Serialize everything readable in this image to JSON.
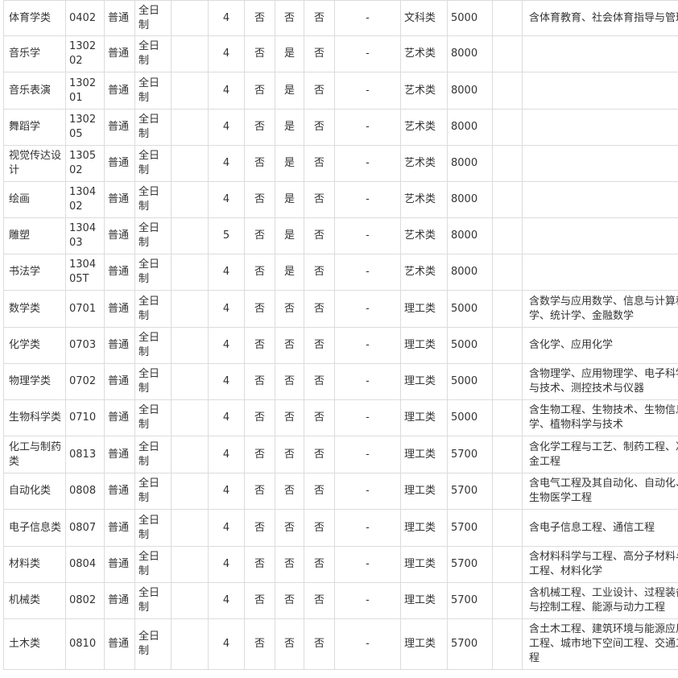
{
  "rows": [
    {
      "major": "体育学类",
      "code": "0402",
      "type": "普通",
      "mode": "全日制",
      "blank": "",
      "years": "4",
      "f1": "否",
      "f2": "否",
      "f3": "否",
      "f4": "-",
      "category": "文科类",
      "fee": "5000",
      "blank2": "",
      "note": "含体育教育、社会体育指导与管理"
    },
    {
      "major": "音乐学",
      "code": "130202",
      "type": "普通",
      "mode": "全日制",
      "blank": "",
      "years": "4",
      "f1": "否",
      "f2": "是",
      "f3": "否",
      "f4": "-",
      "category": "艺术类",
      "fee": "8000",
      "blank2": "",
      "note": ""
    },
    {
      "major": "音乐表演",
      "code": "130201",
      "type": "普通",
      "mode": "全日制",
      "blank": "",
      "years": "4",
      "f1": "否",
      "f2": "是",
      "f3": "否",
      "f4": "-",
      "category": "艺术类",
      "fee": "8000",
      "blank2": "",
      "note": ""
    },
    {
      "major": "舞蹈学",
      "code": "130205",
      "type": "普通",
      "mode": "全日制",
      "blank": "",
      "years": "4",
      "f1": "否",
      "f2": "是",
      "f3": "否",
      "f4": "-",
      "category": "艺术类",
      "fee": "8000",
      "blank2": "",
      "note": ""
    },
    {
      "major": "视觉传达设计",
      "code": "130502",
      "type": "普通",
      "mode": "全日制",
      "blank": "",
      "years": "4",
      "f1": "否",
      "f2": "是",
      "f3": "否",
      "f4": "-",
      "category": "艺术类",
      "fee": "8000",
      "blank2": "",
      "note": ""
    },
    {
      "major": "绘画",
      "code": "130402",
      "type": "普通",
      "mode": "全日制",
      "blank": "",
      "years": "4",
      "f1": "否",
      "f2": "是",
      "f3": "否",
      "f4": "-",
      "category": "艺术类",
      "fee": "8000",
      "blank2": "",
      "note": ""
    },
    {
      "major": "雕塑",
      "code": "130403",
      "type": "普通",
      "mode": "全日制",
      "blank": "",
      "years": "5",
      "f1": "否",
      "f2": "是",
      "f3": "否",
      "f4": "-",
      "category": "艺术类",
      "fee": "8000",
      "blank2": "",
      "note": ""
    },
    {
      "major": "书法学",
      "code": "130405T",
      "type": "普通",
      "mode": "全日制",
      "blank": "",
      "years": "4",
      "f1": "否",
      "f2": "是",
      "f3": "否",
      "f4": "-",
      "category": "艺术类",
      "fee": "8000",
      "blank2": "",
      "note": ""
    },
    {
      "major": "数学类",
      "code": "0701",
      "type": "普通",
      "mode": "全日制",
      "blank": "",
      "years": "4",
      "f1": "否",
      "f2": "否",
      "f3": "否",
      "f4": "-",
      "category": "理工类",
      "fee": "5000",
      "blank2": "",
      "note": "含数学与应用数学、信息与计算科学、统计学、金融数学"
    },
    {
      "major": "化学类",
      "code": "0703",
      "type": "普通",
      "mode": "全日制",
      "blank": "",
      "years": "4",
      "f1": "否",
      "f2": "否",
      "f3": "否",
      "f4": "-",
      "category": "理工类",
      "fee": "5000",
      "blank2": "",
      "note": "含化学、应用化学"
    },
    {
      "major": "物理学类",
      "code": "0702",
      "type": "普通",
      "mode": "全日制",
      "blank": "",
      "years": "4",
      "f1": "否",
      "f2": "否",
      "f3": "否",
      "f4": "-",
      "category": "理工类",
      "fee": "5000",
      "blank2": "",
      "note": "含物理学、应用物理学、电子科学与技术、测控技术与仪器"
    },
    {
      "major": "生物科学类",
      "code": "0710",
      "type": "普通",
      "mode": "全日制",
      "blank": "",
      "years": "4",
      "f1": "否",
      "f2": "否",
      "f3": "否",
      "f4": "-",
      "category": "理工类",
      "fee": "5000",
      "blank2": "",
      "note": "含生物工程、生物技术、生物信息学、植物科学与技术"
    },
    {
      "major": "化工与制药类",
      "code": "0813",
      "type": "普通",
      "mode": "全日制",
      "blank": "",
      "years": "4",
      "f1": "否",
      "f2": "否",
      "f3": "否",
      "f4": "-",
      "category": "理工类",
      "fee": "5700",
      "blank2": "",
      "note": "含化学工程与工艺、制药工程、冶金工程"
    },
    {
      "major": "自动化类",
      "code": "0808",
      "type": "普通",
      "mode": "全日制",
      "blank": "",
      "years": "4",
      "f1": "否",
      "f2": "否",
      "f3": "否",
      "f4": "-",
      "category": "理工类",
      "fee": "5700",
      "blank2": "",
      "note": "含电气工程及其自动化、自动化、生物医学工程"
    },
    {
      "major": "电子信息类",
      "code": "0807",
      "type": "普通",
      "mode": "全日制",
      "blank": "",
      "years": "4",
      "f1": "否",
      "f2": "否",
      "f3": "否",
      "f4": "-",
      "category": "理工类",
      "fee": "5700",
      "blank2": "",
      "note": "含电子信息工程、通信工程"
    },
    {
      "major": "材料类",
      "code": "0804",
      "type": "普通",
      "mode": "全日制",
      "blank": "",
      "years": "4",
      "f1": "否",
      "f2": "否",
      "f3": "否",
      "f4": "-",
      "category": "理工类",
      "fee": "5700",
      "blank2": "",
      "note": "含材料科学与工程、高分子材料与工程、材料化学"
    },
    {
      "major": "机械类",
      "code": "0802",
      "type": "普通",
      "mode": "全日制",
      "blank": "",
      "years": "4",
      "f1": "否",
      "f2": "否",
      "f3": "否",
      "f4": "-",
      "category": "理工类",
      "fee": "5700",
      "blank2": "",
      "note": "含机械工程、工业设计、过程装备与控制工程、能源与动力工程"
    },
    {
      "major": "土木类",
      "code": "0810",
      "type": "普通",
      "mode": "全日制",
      "blank": "",
      "years": "4",
      "f1": "否",
      "f2": "否",
      "f3": "否",
      "f4": "-",
      "category": "理工类",
      "fee": "5700",
      "blank2": "",
      "note": "含土木工程、建筑环境与能源应用工程、城市地下空间工程、交通工程"
    }
  ]
}
